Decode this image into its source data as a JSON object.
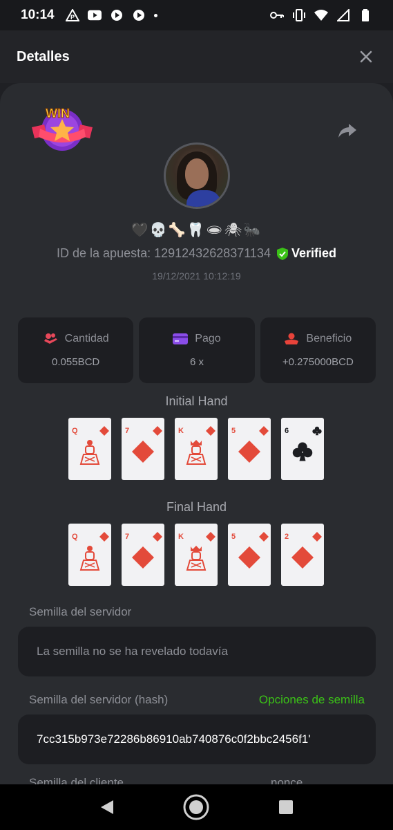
{
  "status_bar": {
    "time": "10:14",
    "left_icons": [
      "parking-notification-icon",
      "youtube-icon",
      "play-icon",
      "play-icon",
      "dot-icon"
    ],
    "right_icons": [
      "key-icon",
      "vibrate-icon",
      "wifi-icon",
      "signal-icon",
      "battery-icon"
    ]
  },
  "modal": {
    "title": "Detalles"
  },
  "bet": {
    "emoji_name": "🖤💀🦴🦷🕳🕷🐜",
    "id_label": "ID de la apuesta: 12912432628371134",
    "verified_label": "Verified",
    "date": "19/12/2021 10:12:19"
  },
  "stats": [
    {
      "label": "Cantidad",
      "value": "0.055BCD",
      "icon": "coins-hand-icon",
      "color": "#e8485a"
    },
    {
      "label": "Pago",
      "value": "6 x",
      "icon": "card-payment-icon",
      "color": "#8a4de8"
    },
    {
      "label": "Beneficio",
      "value": "+0.275000BCD",
      "icon": "profit-hand-icon",
      "color": "#e8433a"
    }
  ],
  "initial_hand": {
    "title": "Initial Hand",
    "cards": [
      {
        "rank": "Q",
        "suit": "diamonds"
      },
      {
        "rank": "7",
        "suit": "diamonds"
      },
      {
        "rank": "K",
        "suit": "diamonds"
      },
      {
        "rank": "5",
        "suit": "diamonds"
      },
      {
        "rank": "6",
        "suit": "clubs"
      }
    ]
  },
  "final_hand": {
    "title": "Final Hand",
    "cards": [
      {
        "rank": "Q",
        "suit": "diamonds"
      },
      {
        "rank": "7",
        "suit": "diamonds"
      },
      {
        "rank": "K",
        "suit": "diamonds"
      },
      {
        "rank": "5",
        "suit": "diamonds"
      },
      {
        "rank": "2",
        "suit": "diamonds"
      }
    ]
  },
  "server_seed": {
    "label": "Semilla del servidor",
    "value": "La semilla no se ha revelado todavía"
  },
  "server_seed_hash": {
    "label": "Semilla del servidor (hash)",
    "options_link": "Opciones de semilla",
    "value": "7cc315b973e72286b86910ab740876c0f2bbc2456f1'"
  },
  "client_seed": {
    "label": "Semilla del cliente",
    "nonce_label": "nonce"
  },
  "colors": {
    "accent_green": "#3bc117",
    "card_red": "#e34a3a"
  }
}
